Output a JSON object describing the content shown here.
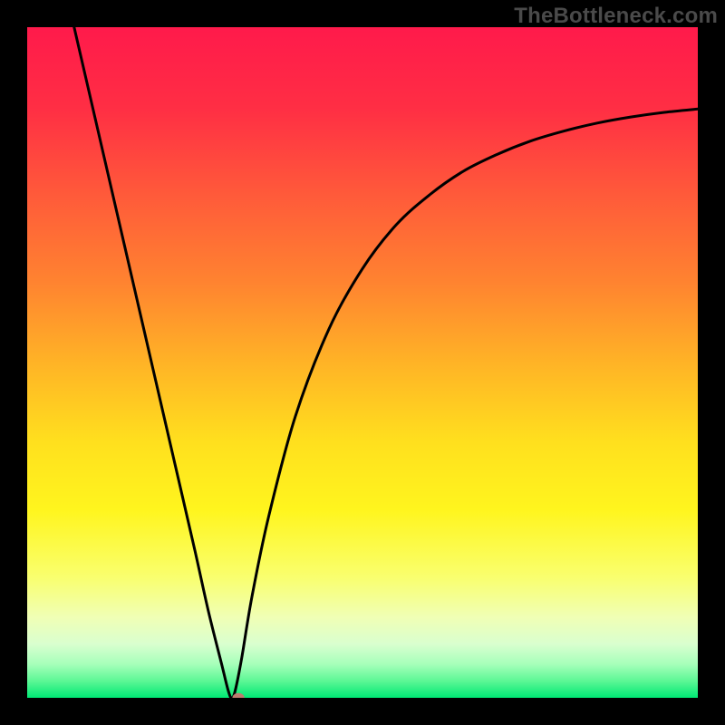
{
  "watermark": "TheBottleneck.com",
  "chart_data": {
    "type": "line",
    "title": "",
    "xlabel": "",
    "ylabel": "",
    "xlim": [
      0,
      100
    ],
    "ylim": [
      0,
      100
    ],
    "series": [
      {
        "name": "curve",
        "x": [
          7,
          10,
          13,
          16,
          19,
          22,
          25,
          27,
          29,
          30,
          30.5,
          31,
          32,
          33.5,
          36,
          40,
          45,
          50,
          55,
          60,
          65,
          70,
          75,
          80,
          85,
          90,
          95,
          100
        ],
        "y": [
          100,
          87,
          74,
          61,
          48,
          35,
          22,
          13,
          5,
          1,
          0,
          1,
          6,
          15,
          27,
          42,
          55,
          64,
          70.5,
          75,
          78.5,
          81,
          83,
          84.5,
          85.7,
          86.6,
          87.3,
          87.8
        ]
      }
    ],
    "marker": {
      "x_pct": 31.5,
      "y_pct": 0,
      "radius_pct": 0.9,
      "color": "#bd7c6f"
    },
    "gradient_stops": [
      {
        "offset": 0,
        "color": "#ff1a4b"
      },
      {
        "offset": 12,
        "color": "#ff2e44"
      },
      {
        "offset": 25,
        "color": "#ff5a3a"
      },
      {
        "offset": 38,
        "color": "#ff8330"
      },
      {
        "offset": 50,
        "color": "#ffb326"
      },
      {
        "offset": 62,
        "color": "#ffe01e"
      },
      {
        "offset": 72,
        "color": "#fff51e"
      },
      {
        "offset": 82,
        "color": "#f9ff6e"
      },
      {
        "offset": 88,
        "color": "#f0ffb5"
      },
      {
        "offset": 92,
        "color": "#d9ffcf"
      },
      {
        "offset": 95,
        "color": "#a6ffba"
      },
      {
        "offset": 97.5,
        "color": "#5cf795"
      },
      {
        "offset": 100,
        "color": "#00e874"
      }
    ]
  }
}
